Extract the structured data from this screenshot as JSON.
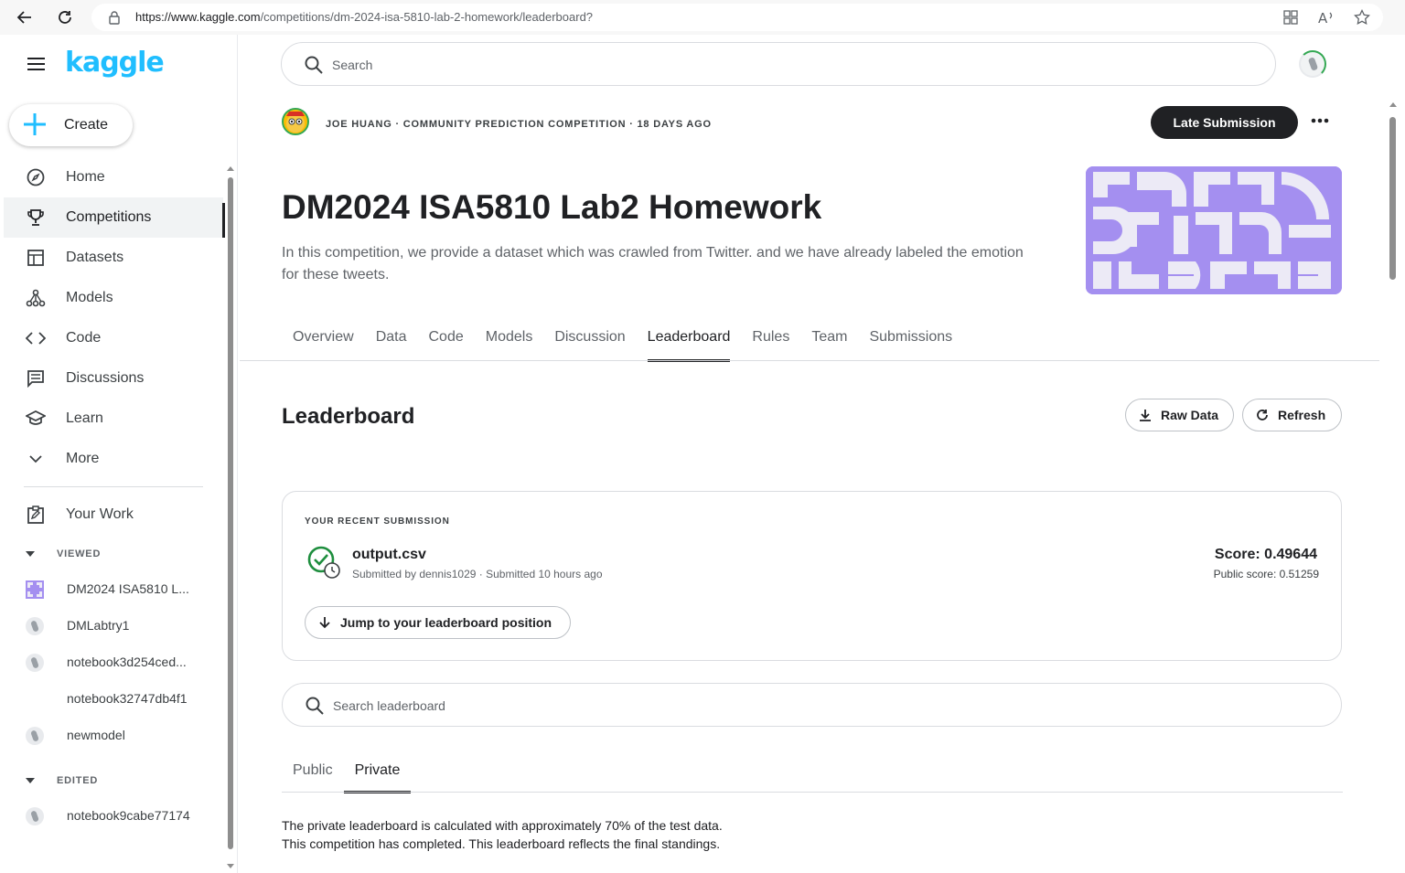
{
  "browser": {
    "url_prefix": "https://www.kaggle.com",
    "url_path": "/competitions/dm-2024-isa-5810-lab-2-homework/leaderboard?"
  },
  "sidebar": {
    "logo": "kaggle",
    "create_label": "Create",
    "nav_items": [
      {
        "label": "Home",
        "icon": "compass-icon"
      },
      {
        "label": "Competitions",
        "icon": "trophy-icon"
      },
      {
        "label": "Datasets",
        "icon": "table-icon"
      },
      {
        "label": "Models",
        "icon": "models-icon"
      },
      {
        "label": "Code",
        "icon": "code-icon"
      },
      {
        "label": "Discussions",
        "icon": "discussion-icon"
      },
      {
        "label": "Learn",
        "icon": "school-icon"
      },
      {
        "label": "More",
        "icon": "chevron-down-icon"
      }
    ],
    "your_work_label": "Your Work",
    "viewed_label": "VIEWED",
    "viewed_items": [
      {
        "label": "DM2024 ISA5810 L..."
      },
      {
        "label": "DMLabtry1"
      },
      {
        "label": "notebook3d254ced..."
      },
      {
        "label": "notebook32747db4f1"
      },
      {
        "label": "newmodel"
      }
    ],
    "edited_label": "EDITED",
    "edited_items": [
      {
        "label": "notebook9cabe77174"
      }
    ]
  },
  "header": {
    "search_placeholder": "Search"
  },
  "competition": {
    "host_line": "JOE HUANG · COMMUNITY PREDICTION COMPETITION · 18 DAYS AGO",
    "late_submission_label": "Late Submission",
    "more_label": "•••",
    "title": "DM2024 ISA5810 Lab2 Homework",
    "description": "In this competition, we provide a dataset which was crawled from Twitter. and we have already labeled the emotion for these tweets.",
    "hero_color": "#a48ff0",
    "tabs": [
      "Overview",
      "Data",
      "Code",
      "Models",
      "Discussion",
      "Leaderboard",
      "Rules",
      "Team",
      "Submissions"
    ],
    "active_tab": "Leaderboard"
  },
  "leaderboard": {
    "title": "Leaderboard",
    "raw_data_label": "Raw Data",
    "refresh_label": "Refresh",
    "recent": {
      "heading": "YOUR RECENT SUBMISSION",
      "file_name": "output.csv",
      "meta": "Submitted by dennis1029 · Submitted 10 hours ago",
      "score": "Score: 0.49644",
      "public_score": "Public score: 0.51259",
      "jump_label": "Jump to your leaderboard position"
    },
    "search_placeholder": "Search leaderboard",
    "sub_tabs": [
      "Public",
      "Private"
    ],
    "active_sub_tab": "Private",
    "note_line1": "The private leaderboard is calculated with approximately 70% of the test data.",
    "note_line2": "This competition has completed. This leaderboard reflects the final standings."
  },
  "colors": {
    "brand": "#20beff",
    "success": "#1e8e3e",
    "dark": "#202124"
  }
}
